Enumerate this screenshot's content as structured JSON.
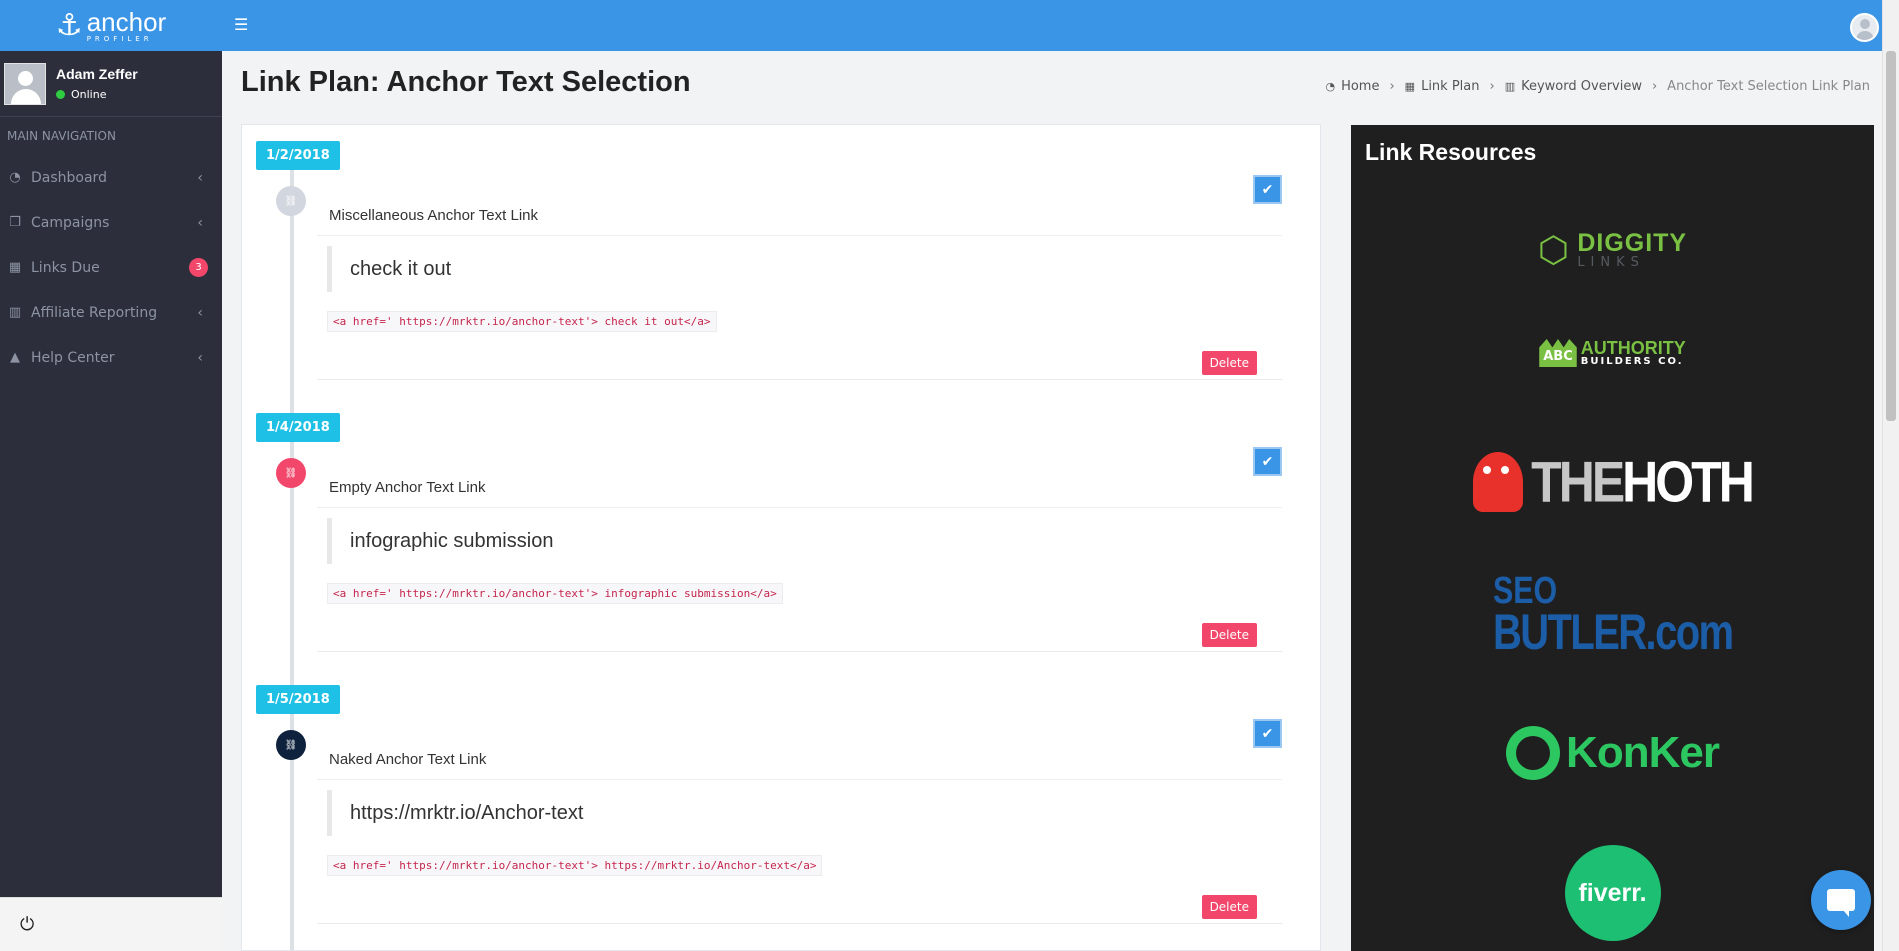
{
  "app": {
    "logo_text": "anchor",
    "logo_subtext": "PROFILER"
  },
  "user": {
    "name": "Adam Zeffer",
    "status": "Online"
  },
  "nav": {
    "header": "MAIN NAVIGATION",
    "items": [
      {
        "label": "Dashboard",
        "icon": "tachometer-icon"
      },
      {
        "label": "Campaigns",
        "icon": "copy-icon"
      },
      {
        "label": "Links Due",
        "icon": "calendar-icon",
        "badge": "3"
      },
      {
        "label": "Affiliate Reporting",
        "icon": "bar-chart-icon"
      },
      {
        "label": "Help Center",
        "icon": "warning-icon"
      }
    ]
  },
  "page": {
    "title": "Link Plan: Anchor Text Selection"
  },
  "breadcrumb": [
    {
      "label": "Home",
      "icon": "dashboard-icon"
    },
    {
      "label": "Link Plan",
      "icon": "calendar-icon"
    },
    {
      "label": "Keyword Overview",
      "icon": "bar-chart-icon"
    },
    {
      "label": "Anchor Text Selection Link Plan"
    }
  ],
  "timeline": [
    {
      "date": "1/2/2018",
      "node_color": "#d2d6de",
      "title": "Miscellaneous Anchor Text Link",
      "anchor": "check it out",
      "code": "<a href=' https://mrktr.io/anchor-text'> check it out</a>",
      "delete_label": "Delete"
    },
    {
      "date": "1/4/2018",
      "node_color": "#f2476b",
      "title": "Empty Anchor Text Link",
      "anchor": "infographic submission",
      "code": "<a href=' https://mrktr.io/anchor-text'> infographic submission</a>",
      "delete_label": "Delete"
    },
    {
      "date": "1/5/2018",
      "node_color": "#0f223d",
      "title": "Naked Anchor Text Link",
      "anchor": "https://mrktr.io/Anchor-text",
      "code": "<a href=' https://mrktr.io/anchor-text'> https://mrktr.io/Anchor-text</a>",
      "delete_label": "Delete"
    }
  ],
  "resources": {
    "title": "Link Resources",
    "logos": [
      {
        "name": "DIGGITY",
        "sub": "LINKS"
      },
      {
        "name": "AUTHORITY",
        "sub": "BUILDERS CO.",
        "mark": "ABC"
      },
      {
        "name_a": "THE",
        "name_b": "HOTH"
      },
      {
        "line1": "SEO",
        "line2": "BUTLER.com"
      },
      {
        "name": "KonKer"
      },
      {
        "name": "fiverr."
      }
    ]
  },
  "colors": {
    "primary": "#3b95e6",
    "sidebar": "#2c2f3b",
    "date_tag": "#1ec0e6",
    "delete": "#f2476b"
  }
}
